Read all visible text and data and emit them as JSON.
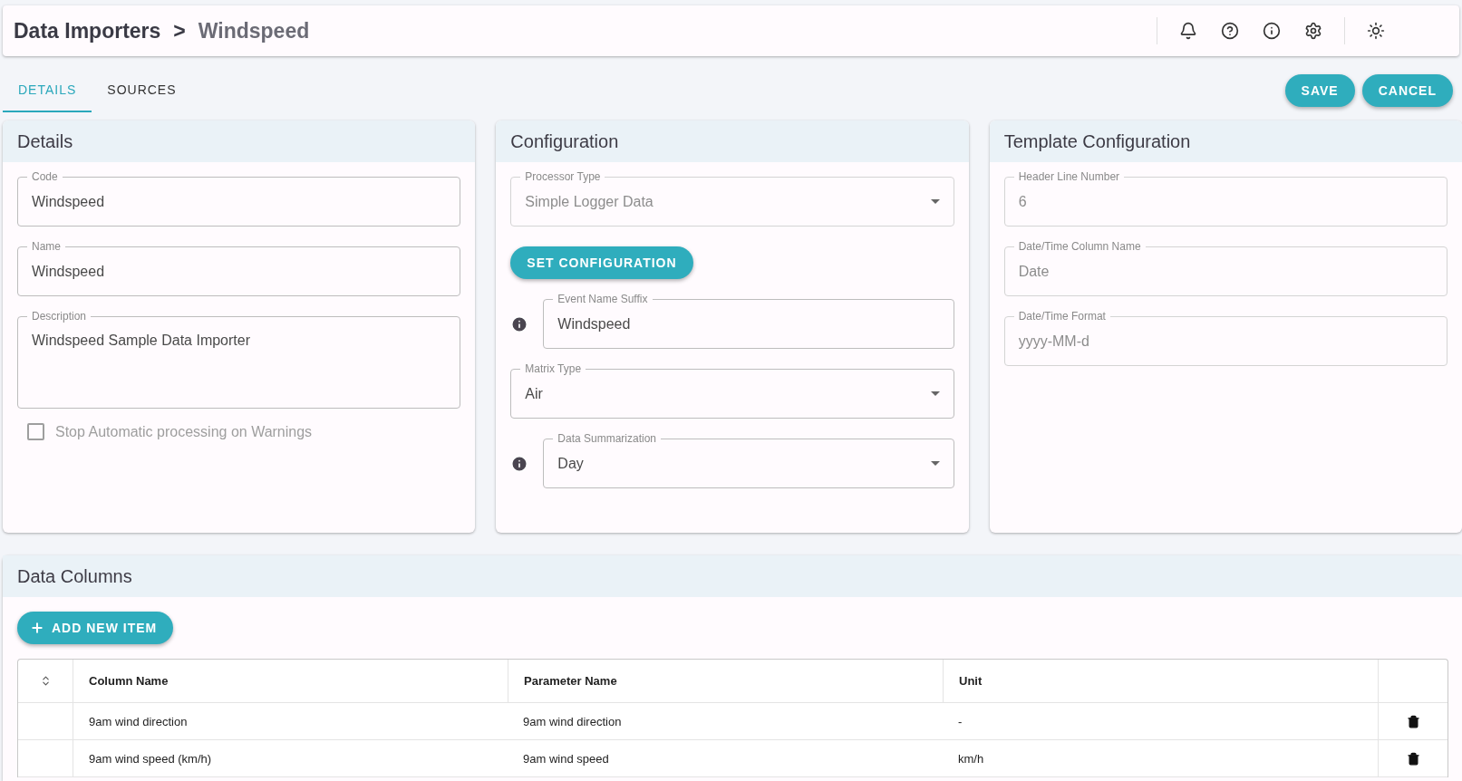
{
  "breadcrumb": {
    "parent": "Data Importers",
    "separator": ">",
    "current": "Windspeed"
  },
  "tabs": [
    {
      "label": "DETAILS",
      "selected": true
    },
    {
      "label": "SOURCES",
      "selected": false
    }
  ],
  "actions": [
    "SAVE",
    "CANCEL"
  ],
  "panels": [
    {
      "title": "Details",
      "fields": [
        {
          "kind": "text",
          "label": "Code",
          "value": "Windspeed",
          "disabled": false,
          "info": false
        },
        {
          "kind": "text",
          "label": "Name",
          "value": "Windspeed",
          "disabled": false,
          "info": false
        },
        {
          "kind": "textarea",
          "label": "Description",
          "value": "Windspeed Sample Data Importer",
          "disabled": false,
          "info": false
        },
        {
          "kind": "checkbox",
          "label": "Stop Automatic processing on Warnings",
          "checked": false,
          "disabled": true
        }
      ]
    },
    {
      "title": "Configuration",
      "fields": [
        {
          "kind": "select",
          "label": "Processor Type",
          "value": "Simple Logger Data",
          "disabled": true,
          "info": false
        },
        {
          "kind": "button",
          "label": "SET CONFIGURATION"
        },
        {
          "kind": "text",
          "label": "Event Name Suffix",
          "value": "Windspeed",
          "disabled": false,
          "info": true
        },
        {
          "kind": "select",
          "label": "Matrix Type",
          "value": "Air",
          "disabled": false,
          "info": false
        },
        {
          "kind": "select",
          "label": "Data Summarization",
          "value": "Day",
          "disabled": false,
          "info": true
        }
      ]
    },
    {
      "title": "Template Configuration",
      "fields": [
        {
          "kind": "text",
          "label": "Header Line Number",
          "value": "6",
          "disabled": true,
          "info": false
        },
        {
          "kind": "text",
          "label": "Date/Time Column Name",
          "value": "Date",
          "disabled": true,
          "info": false
        },
        {
          "kind": "text",
          "label": "Date/Time Format",
          "value": "yyyy-MM-d",
          "disabled": true,
          "info": false
        }
      ]
    }
  ],
  "data_columns": {
    "title": "Data Columns",
    "add_button": "ADD NEW ITEM",
    "columns": [
      "Column Name",
      "Parameter Name",
      "Unit"
    ],
    "rows": [
      {
        "cells": [
          "9am wind direction",
          "9am wind direction",
          "-"
        ]
      },
      {
        "cells": [
          "9am wind speed (km/h)",
          "9am wind speed",
          "km/h"
        ]
      }
    ]
  }
}
